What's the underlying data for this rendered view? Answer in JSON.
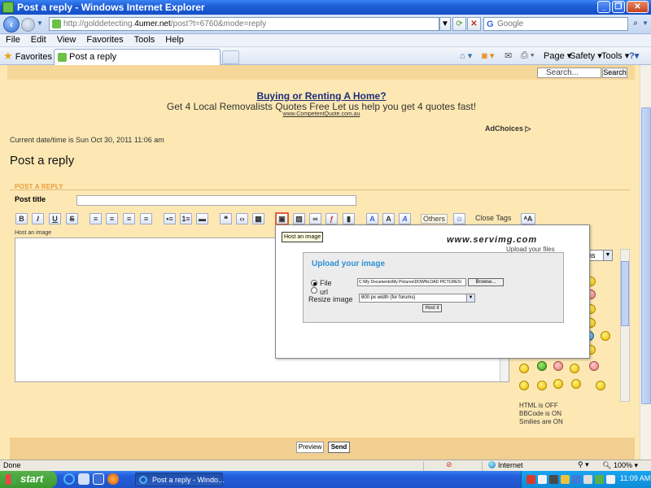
{
  "window": {
    "title": "Post a reply - Windows Internet Explorer",
    "minimize_glyph": "_",
    "maximize_glyph": "❐",
    "close_glyph": "✕"
  },
  "address_bar": {
    "url_prefix": "http://golddetecting.",
    "url_domain": "4umer.net",
    "url_suffix": "/post?t=6760&mode=reply",
    "search_placeholder": "Google"
  },
  "menu": [
    "File",
    "Edit",
    "View",
    "Favorites",
    "Tools",
    "Help"
  ],
  "favorites_bar": {
    "favorites_label": "Favorites",
    "tab_label": "Post a reply",
    "commands": [
      "Page ▾",
      "Safety ▾",
      "Tools ▾"
    ]
  },
  "page": {
    "search_value": "Search...",
    "search_button": "Search",
    "ad": {
      "title": "Buying or Renting A Home?",
      "text": "Get 4 Local Removalists Quotes Free Let us help you get 4 quotes fast!",
      "url": "www.CompetentQuote.com.au",
      "adchoices": "AdChoices ▷"
    },
    "datetime": "Current date/time is Sun Oct 30, 2011 11:06 am",
    "title": "Post a reply",
    "section": "POST A REPLY",
    "post_title_label": "Post title",
    "toolbar": {
      "others": "Others",
      "close_tags": "Close Tags"
    },
    "editor_label": "Host an image",
    "tooltip": "Host an image",
    "popup": {
      "logo": "www.servimg.com",
      "tagline": "Upload your files",
      "upload_title": "Upload your image",
      "file_label": "File",
      "file_value": "C:\\My Documents\\My Pictures\\DOWNLOAD PICTURES\\",
      "browse": "Browse...",
      "url_label": "url",
      "resize_label": "Resize image",
      "resize_value": "800 px width (for forums)",
      "host_button": "Host it"
    },
    "side_select": "ons",
    "status": {
      "html": "HTML is OFF",
      "bbcode": "BBCode is ON",
      "smilies": "Smilies are ON"
    },
    "preview_button": "Preview",
    "send_button": "Send"
  },
  "statusbar": {
    "text": "Done",
    "zone": "Internet",
    "zoom": "100%"
  },
  "taskbar": {
    "start": "start",
    "task": "Post a reply - Windo...",
    "clock": "11:09 AM"
  }
}
